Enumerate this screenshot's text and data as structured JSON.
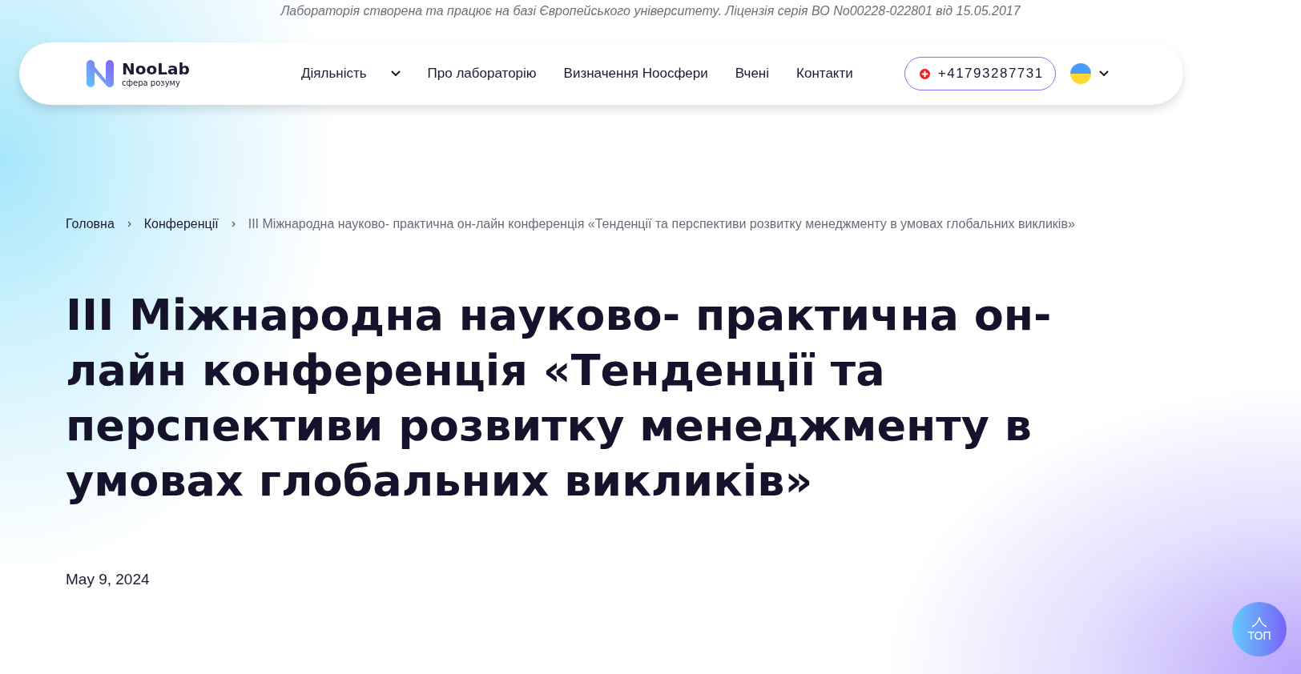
{
  "notice": "Лабораторія створена та працює на базі Європейського університету. Ліцензія серія ВО No00228-022801 від 15.05.2017",
  "logo": {
    "name": "NooLab",
    "tagline": "сфера розуму"
  },
  "nav": [
    {
      "label": "Діяльність",
      "kind": "dropdown"
    },
    {
      "label": "Про лабораторію",
      "kind": "link"
    },
    {
      "label": "Визначення Ноосфери",
      "kind": "link"
    },
    {
      "label": "Вчені",
      "kind": "link"
    },
    {
      "label": "Контакти",
      "kind": "link"
    }
  ],
  "phone": "+41793287731",
  "breadcrumbs": [
    {
      "label": "Головна",
      "current": false
    },
    {
      "label": "Конференції",
      "current": false
    },
    {
      "label": "ІІІ Міжнародна науково- практична он-лайн конференція «Тенденції та перспективи розвитку менеджменту в умовах глобальних викликів»",
      "current": true
    }
  ],
  "title": "ІІІ Міжнародна науково- практична он-лайн конференція «Тенденції та перспективи розвитку менеджменту в умовах глобальних викликів»",
  "date": "May 9, 2024",
  "top_button": {
    "label": "ТОП"
  }
}
